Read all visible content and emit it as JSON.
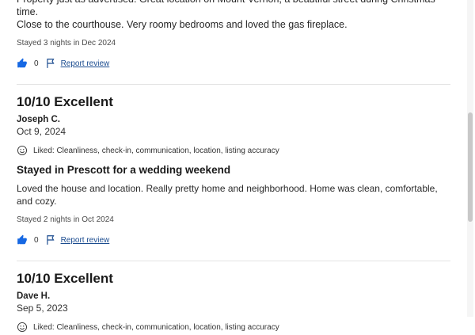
{
  "top_review": {
    "body_line1": "Property just as advertised. Great location on Mount Vernon, a beautiful street during Christmas time.",
    "body_line2": "Close to the courthouse. Very roomy bedrooms and loved the gas fireplace.",
    "stayed": "Stayed 3 nights in Dec 2024",
    "helpful_count": "0",
    "report_label": "Report review"
  },
  "reviews": [
    {
      "rating": "10/10 Excellent",
      "reviewer": "Joseph C.",
      "date": "Oct 9, 2024",
      "liked": "Liked: Cleanliness, check-in, communication, location, listing accuracy",
      "title": "Stayed in Prescott for a wedding weekend",
      "body": "Loved the house and location. Really pretty home and neighborhood. Home was clean, comfortable, and cozy.",
      "stayed": "Stayed 2 nights in Oct 2024",
      "helpful_count": "0",
      "report_label": "Report review"
    },
    {
      "rating": "10/10 Excellent",
      "reviewer": "Dave H.",
      "date": "Sep 5, 2023",
      "liked": "Liked: Cleanliness, check-in, communication, location, listing accuracy"
    }
  ],
  "icons": {
    "thumbs_up": "thumbs-up-icon",
    "flag": "flag-icon",
    "smile": "smile-icon"
  },
  "colors": {
    "link": "#1a4b8f",
    "thumb": "#1668e3"
  }
}
